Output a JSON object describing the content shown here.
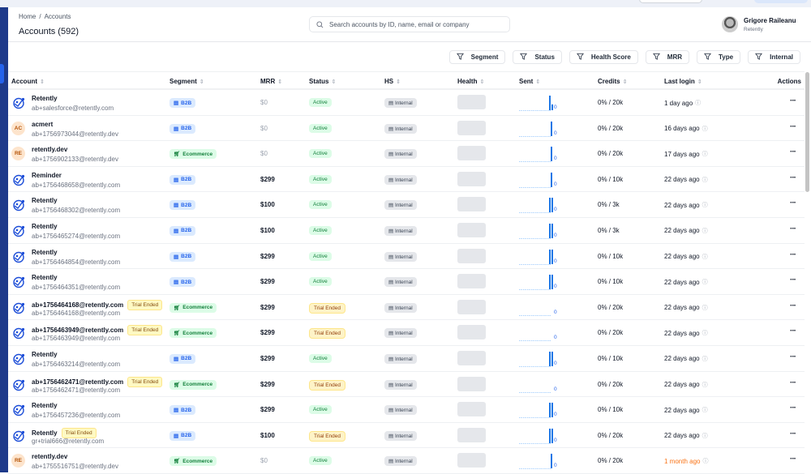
{
  "header": {
    "breadcrumb": [
      "Home",
      "Accounts"
    ],
    "title": "Accounts (592)",
    "search_placeholder": "Search accounts by ID, name, email or company",
    "user": {
      "name": "Grigore Raileanu",
      "org": "Retently"
    }
  },
  "filters": [
    "Segment",
    "Status",
    "Health Score",
    "MRR",
    "Type",
    "Internal"
  ],
  "columns": [
    "Account",
    "Segment",
    "MRR",
    "Status",
    "HS",
    "Health",
    "Sent",
    "Credits",
    "Last login",
    "Actions"
  ],
  "colors": {
    "sidebar": "#1e3a8a",
    "accent": "#2563eb",
    "active_bg": "#dcfce7",
    "trial_bg": "#fef3c7",
    "old_login": "#f97316"
  },
  "rows": [
    {
      "avatar": "logo",
      "name": "Retently",
      "email": "ab+salesforce@retently.com",
      "segment": "B2B",
      "mrr": "$0",
      "status": "Active",
      "hs": "Internal",
      "sent_bars": [
        1,
        0.4
      ],
      "sent": "0",
      "credits": "0% / 20k",
      "last_login": "1 day ago"
    },
    {
      "avatar": "AC",
      "name": "acmert",
      "email": "ab+1756973044@retently.dev",
      "segment": "B2B",
      "mrr": "$0",
      "status": "Active",
      "hs": "Internal",
      "sent_bars": [
        1
      ],
      "sent": "0",
      "credits": "0% / 20k",
      "last_login": "16 days ago"
    },
    {
      "avatar": "RE",
      "name": "retently.dev",
      "email": "ab+1756902133@retently.dev",
      "segment": "Ecommerce",
      "mrr": "$0",
      "status": "Active",
      "hs": "Internal",
      "sent_bars": [
        1
      ],
      "sent": "0",
      "credits": "0% / 20k",
      "last_login": "17 days ago"
    },
    {
      "avatar": "logo",
      "name": "Reminder",
      "email": "ab+1756468658@retently.com",
      "segment": "B2B",
      "mrr": "$299",
      "status": "Active",
      "hs": "Internal",
      "sent_bars": [
        1
      ],
      "sent": "0",
      "credits": "0% / 10k",
      "last_login": "22 days ago"
    },
    {
      "avatar": "logo",
      "name": "Retently",
      "email": "ab+1756468302@retently.com",
      "segment": "B2B",
      "mrr": "$100",
      "status": "Active",
      "hs": "Internal",
      "sent_bars": [
        1,
        1
      ],
      "sent": "0",
      "credits": "0% / 3k",
      "last_login": "22 days ago"
    },
    {
      "avatar": "logo",
      "name": "Retently",
      "email": "ab+1756465274@retently.com",
      "segment": "B2B",
      "mrr": "$100",
      "status": "Active",
      "hs": "Internal",
      "sent_bars": [
        1,
        1
      ],
      "sent": "0",
      "credits": "0% / 3k",
      "last_login": "22 days ago"
    },
    {
      "avatar": "logo",
      "name": "Retently",
      "email": "ab+1756464854@retently.com",
      "segment": "B2B",
      "mrr": "$299",
      "status": "Active",
      "hs": "Internal",
      "sent_bars": [
        1,
        1
      ],
      "sent": "0",
      "credits": "0% / 10k",
      "last_login": "22 days ago"
    },
    {
      "avatar": "logo",
      "name": "Retently",
      "email": "ab+1756464351@retently.com",
      "segment": "B2B",
      "mrr": "$299",
      "status": "Active",
      "hs": "Internal",
      "sent_bars": [
        1,
        1
      ],
      "sent": "0",
      "credits": "0% / 10k",
      "last_login": "22 days ago"
    },
    {
      "avatar": "logo",
      "name": "ab+1756464168@retently.com",
      "badge": "Trial Ended",
      "email": "ab+1756464168@retently.com",
      "segment": "Ecommerce",
      "mrr": "$299",
      "status": "Trial Ended",
      "hs": "Internal",
      "sent_bars": [],
      "sent": "0",
      "credits": "0% / 20k",
      "last_login": "22 days ago"
    },
    {
      "avatar": "logo",
      "name": "ab+1756463949@retently.com",
      "badge": "Trial Ended",
      "email": "ab+1756463949@retently.com",
      "segment": "Ecommerce",
      "mrr": "$299",
      "status": "Trial Ended",
      "hs": "Internal",
      "sent_bars": [],
      "sent": "0",
      "credits": "0% / 20k",
      "last_login": "22 days ago"
    },
    {
      "avatar": "logo",
      "name": "Retently",
      "email": "ab+1756463214@retently.com",
      "segment": "B2B",
      "mrr": "$299",
      "status": "Active",
      "hs": "Internal",
      "sent_bars": [
        1,
        1
      ],
      "sent": "0",
      "credits": "0% / 10k",
      "last_login": "22 days ago"
    },
    {
      "avatar": "logo",
      "name": "ab+1756462471@retently.com",
      "badge": "Trial Ended",
      "email": "ab+1756462471@retently.com",
      "segment": "Ecommerce",
      "mrr": "$299",
      "status": "Trial Ended",
      "hs": "Internal",
      "sent_bars": [],
      "sent": "0",
      "credits": "0% / 20k",
      "last_login": "22 days ago"
    },
    {
      "avatar": "logo",
      "name": "Retently",
      "email": "ab+1756457236@retently.com",
      "segment": "B2B",
      "mrr": "$299",
      "status": "Active",
      "hs": "Internal",
      "sent_bars": [
        1,
        1
      ],
      "sent": "0",
      "credits": "0% / 10k",
      "last_login": "22 days ago"
    },
    {
      "avatar": "logo",
      "name": "Retently",
      "badge": "Trial Ended",
      "email": "gr+trial666@retently.com",
      "segment": "B2B",
      "mrr": "$100",
      "status": "Trial Ended",
      "hs": "Internal",
      "sent_bars": [
        1,
        1
      ],
      "sent": "0",
      "credits": "0% / 20k",
      "last_login": "22 days ago"
    },
    {
      "avatar": "RE",
      "name": "retently.dev",
      "email": "ab+1755516751@retently.dev",
      "segment": "Ecommerce",
      "mrr": "$0",
      "status": "Active",
      "hs": "Internal",
      "sent_bars": [
        1
      ],
      "sent": "0",
      "credits": "0% / 20k",
      "last_login": "1 month ago",
      "login_old": true
    }
  ]
}
